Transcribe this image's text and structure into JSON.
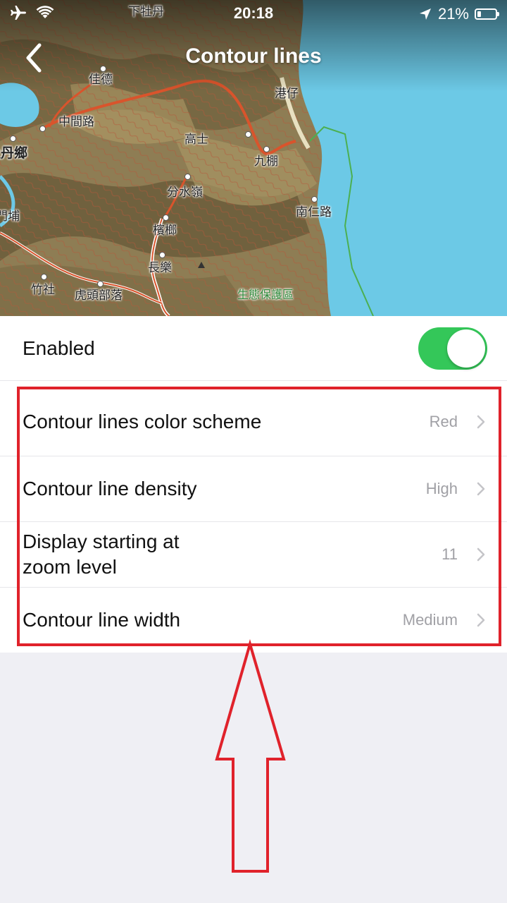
{
  "status_bar": {
    "time": "20:18",
    "battery_percent": "21%",
    "icons": [
      "airplane-icon",
      "wifi-icon",
      "location-arrow-icon",
      "battery-icon"
    ]
  },
  "nav": {
    "title": "Contour lines",
    "back_icon": "chevron-left-icon"
  },
  "map": {
    "places": [
      "下牡丹",
      "佳德",
      "港仔",
      "中間路",
      "高士",
      "牡丹鄉",
      "九棚",
      "分水嶺",
      "南仁路",
      "門埔",
      "檳榔",
      "長樂",
      "竹社",
      "虎頭部落",
      "生態保護區"
    ]
  },
  "settings": {
    "enabled": {
      "label": "Enabled",
      "on": true
    },
    "rows": [
      {
        "label": "Contour lines color scheme",
        "value": "Red"
      },
      {
        "label": "Contour line density",
        "value": "High"
      },
      {
        "label_line1": "Display starting at",
        "label_line2": "zoom level",
        "value": "11"
      },
      {
        "label": "Contour line width",
        "value": "Medium"
      }
    ]
  },
  "colors": {
    "toggle_on": "#34c759",
    "annotation_red": "#e0222b",
    "sea": "#6cc9e6",
    "background": "#efeff4"
  }
}
